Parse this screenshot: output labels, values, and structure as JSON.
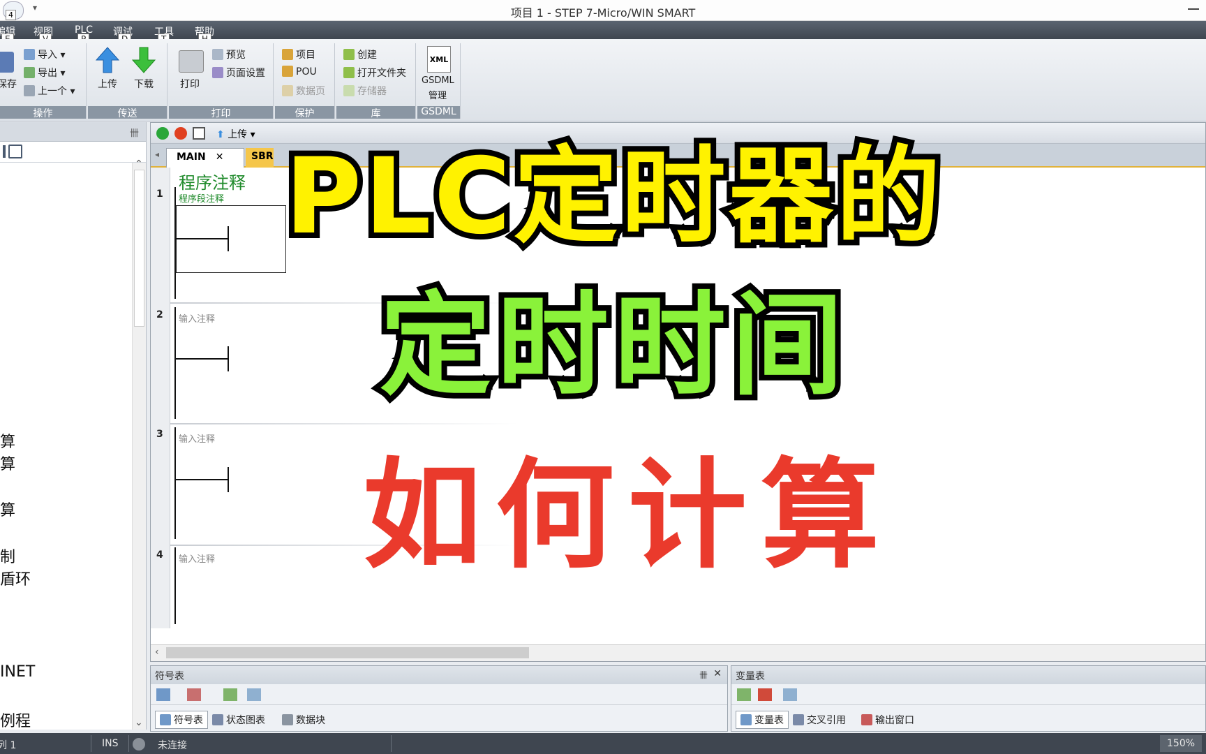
{
  "window": {
    "title": "项目 1 - STEP 7-Micro/WIN SMART",
    "qa_num": "4"
  },
  "menu": [
    {
      "label": "编辑",
      "key": "E"
    },
    {
      "label": "视图",
      "key": "V"
    },
    {
      "label": "PLC",
      "key": "P"
    },
    {
      "label": "调试",
      "key": "D"
    },
    {
      "label": "工具",
      "key": "T"
    },
    {
      "label": "帮助",
      "key": "H"
    }
  ],
  "ribbon": {
    "file": {
      "save": "保存",
      "import": "导入",
      "export": "导出",
      "prev": "上一个",
      "group": "操作"
    },
    "transfer": {
      "upload": "上传",
      "download": "下载",
      "group": "传送"
    },
    "print": {
      "print": "打印",
      "preview": "预览",
      "page_setup": "页面设置",
      "group": "打印"
    },
    "protect": {
      "project": "项目",
      "pou": "POU",
      "data_page": "数据页",
      "group": "保护"
    },
    "library": {
      "create": "创建",
      "open_folder": "打开文件夹",
      "memory": "存储器",
      "group": "库"
    },
    "gsdml": {
      "xml": "XML",
      "label": "GSDML",
      "manage": "管理",
      "group": "GSDML"
    }
  },
  "sidebar": {
    "items": [
      "算",
      "算",
      "算",
      "制",
      "盾环",
      "INET",
      "例程"
    ]
  },
  "editor": {
    "toolbar_upload": "上传",
    "tabs": [
      {
        "label": "MAIN"
      },
      {
        "label": "SBR"
      }
    ],
    "program_comment": "程序注释",
    "networks": [
      {
        "num": "1",
        "comment": "程序段注释"
      },
      {
        "num": "2",
        "comment": "输入注释"
      },
      {
        "num": "3",
        "comment": "输入注释"
      },
      {
        "num": "4",
        "comment": "输入注释"
      }
    ]
  },
  "symbol_panel": {
    "title": "符号表",
    "tabs": [
      "符号表",
      "状态图表",
      "数据块"
    ]
  },
  "var_panel": {
    "title": "变量表",
    "tabs": [
      "变量表",
      "交叉引用",
      "输出窗口"
    ]
  },
  "status": {
    "pos": "列 1",
    "mode": "INS",
    "conn": "未连接",
    "zoom": "150%"
  },
  "overlay": {
    "line1": "PLC定时器的",
    "line2": "定时时间",
    "line3": "如何计算"
  }
}
